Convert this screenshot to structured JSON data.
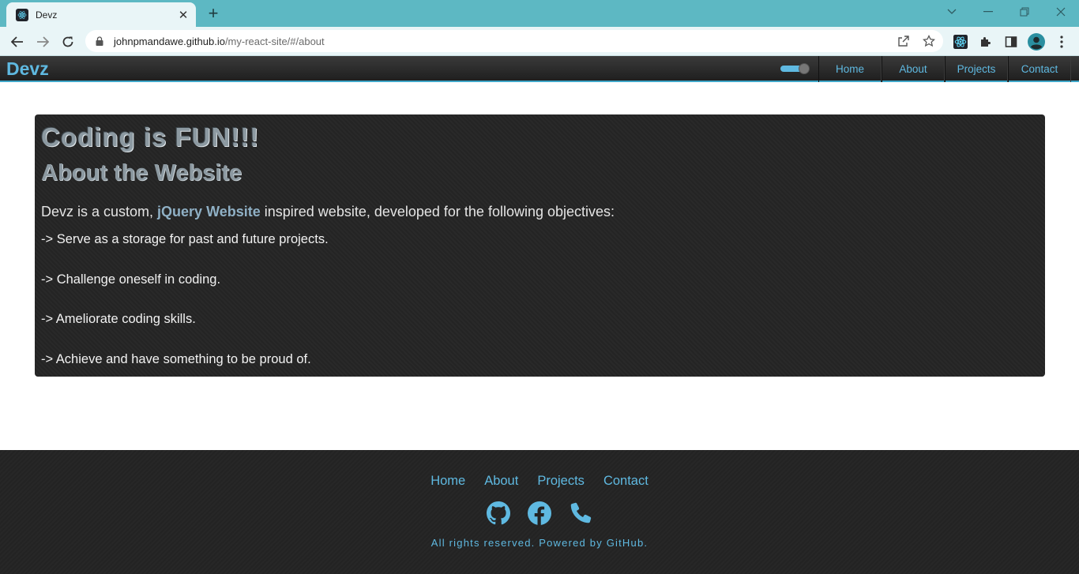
{
  "browser": {
    "tab_title": "Devz",
    "tab_close": "✕",
    "new_tab": "+",
    "url_domain": "johnpmandawe.github.io",
    "url_path": "/my-react-site/#/about",
    "accent_color": "#5db8c3"
  },
  "navbar": {
    "brand": "Devz",
    "links": [
      "Home",
      "About",
      "Projects",
      "Contact"
    ],
    "accent_color": "#5fb9e1"
  },
  "about": {
    "heading": "Coding is FUN!!!",
    "subheading": "About the Website",
    "intro_before": "Devz is a custom, ",
    "intro_highlight": "jQuery Website",
    "intro_after": " inspired website, developed for the following objectives:",
    "objectives": [
      "-> Serve as a storage for past and future projects.",
      "-> Challenge oneself in coding.",
      "-> Ameliorate coding skills.",
      "-> Achieve and have something to be proud of."
    ]
  },
  "footer": {
    "links": [
      "Home",
      "About",
      "Projects",
      "Contact"
    ],
    "icons": [
      "github-icon",
      "facebook-icon",
      "phone-icon"
    ],
    "copyright": "All rights reserved. Powered by GitHub."
  }
}
